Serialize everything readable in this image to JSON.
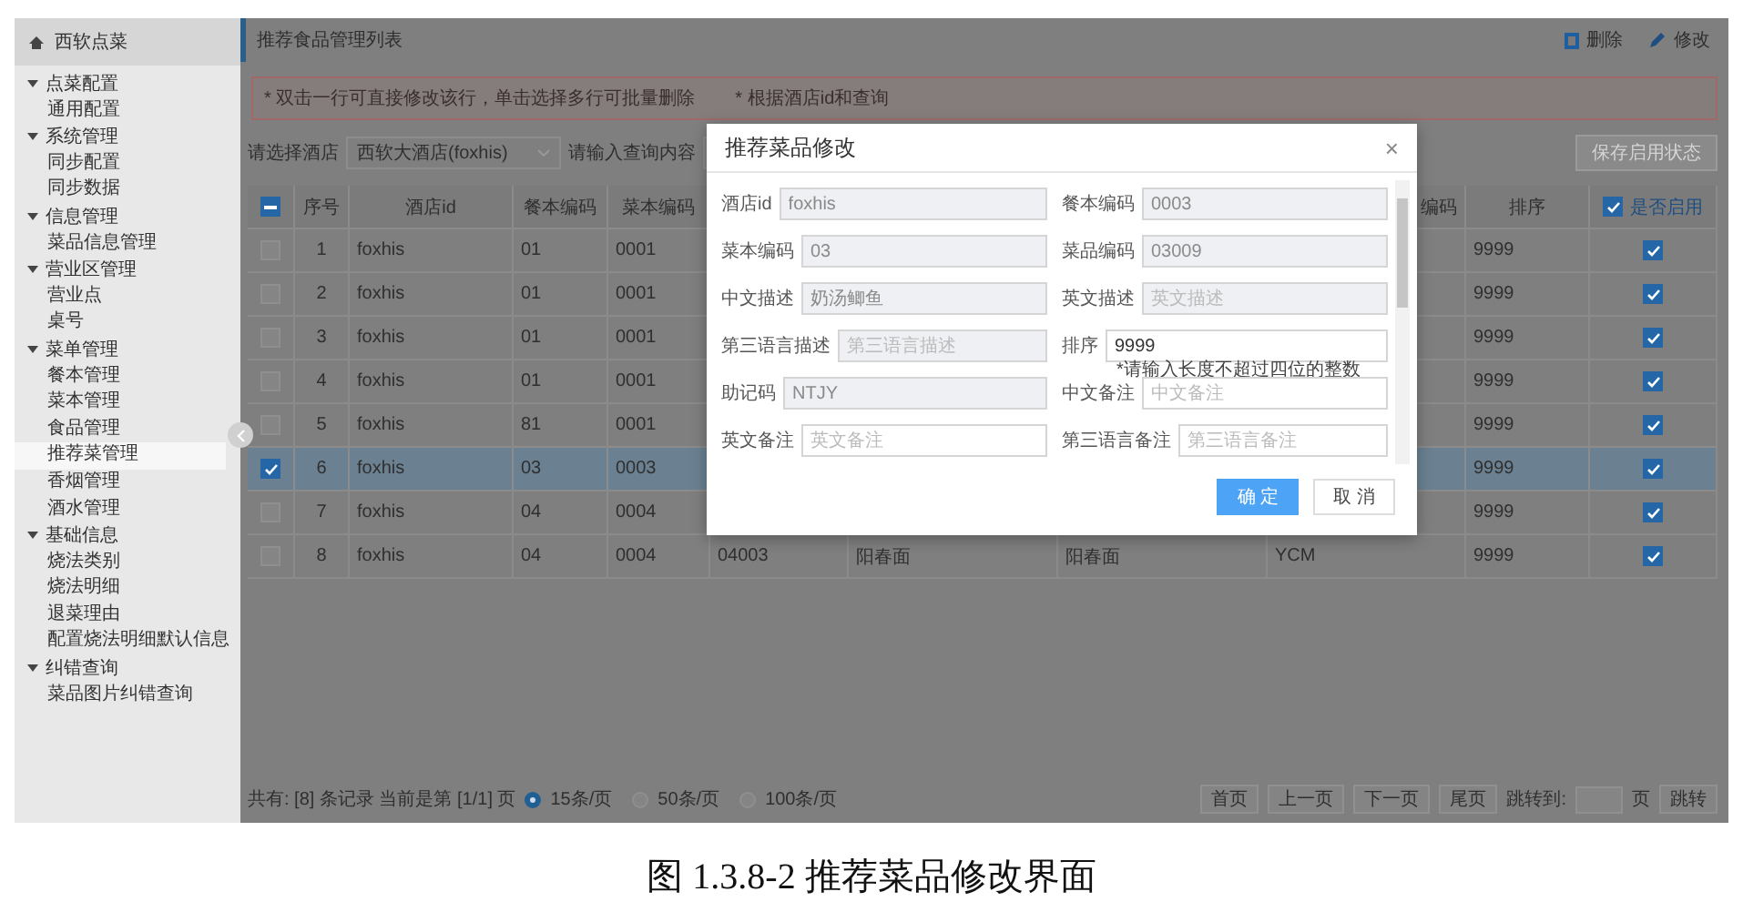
{
  "sidebar": {
    "title": "西软点菜",
    "groups": [
      {
        "label": "点菜配置",
        "expanded": true,
        "children": [
          {
            "label": "通用配置",
            "selected": false
          }
        ]
      },
      {
        "label": "系统管理",
        "expanded": true,
        "children": [
          {
            "label": "同步配置",
            "selected": false
          },
          {
            "label": "同步数据",
            "selected": false
          }
        ]
      },
      {
        "label": "信息管理",
        "expanded": true,
        "children": [
          {
            "label": "菜品信息管理",
            "selected": false
          }
        ]
      },
      {
        "label": "营业区管理",
        "expanded": true,
        "children": [
          {
            "label": "营业点",
            "selected": false
          },
          {
            "label": "桌号",
            "selected": false
          }
        ]
      },
      {
        "label": "菜单管理",
        "expanded": true,
        "children": [
          {
            "label": "餐本管理",
            "selected": false
          },
          {
            "label": "菜本管理",
            "selected": false
          },
          {
            "label": "食品管理",
            "selected": false
          },
          {
            "label": "推荐菜管理",
            "selected": true
          },
          {
            "label": "香烟管理",
            "selected": false
          },
          {
            "label": "酒水管理",
            "selected": false
          }
        ]
      },
      {
        "label": "基础信息",
        "expanded": true,
        "children": [
          {
            "label": "烧法类别",
            "selected": false
          },
          {
            "label": "烧法明细",
            "selected": false
          },
          {
            "label": "退菜理由",
            "selected": false
          },
          {
            "label": "配置烧法明细默认信息",
            "selected": false
          }
        ]
      },
      {
        "label": "纠错查询",
        "expanded": true,
        "children": [
          {
            "label": "菜品图片纠错查询",
            "selected": false
          }
        ]
      }
    ]
  },
  "page_title": "推荐食品管理列表",
  "toolbar": [
    {
      "kind": "delete",
      "label": "删除"
    },
    {
      "kind": "edit",
      "label": "修改"
    }
  ],
  "notices": [
    "* 双击一行可直接修改该行，单击选择多行可批量删除",
    "* 根据酒店id和查询"
  ],
  "filter": {
    "hotel_label": "请选择酒店",
    "hotel_value": "西软大酒店(foxhis)",
    "query_label": "请输入查询内容",
    "save_button": "保存启用状态"
  },
  "table": {
    "select_all_indeterminate": true,
    "columns": [
      "序号",
      "酒店id",
      "餐本编码",
      "菜本编码",
      "编码",
      "排序",
      "是否启用"
    ],
    "enable_all_checked": true,
    "rows": [
      {
        "no": "1",
        "hotel_id": "foxhis",
        "menu_code": "01",
        "book_code": "0001",
        "sort": "9999",
        "checked": false,
        "enabled": true,
        "selected": false
      },
      {
        "no": "2",
        "hotel_id": "foxhis",
        "menu_code": "01",
        "book_code": "0001",
        "sort": "9999",
        "checked": false,
        "enabled": true,
        "selected": false
      },
      {
        "no": "3",
        "hotel_id": "foxhis",
        "menu_code": "01",
        "book_code": "0001",
        "sort": "9999",
        "checked": false,
        "enabled": true,
        "selected": false
      },
      {
        "no": "4",
        "hotel_id": "foxhis",
        "menu_code": "01",
        "book_code": "0001",
        "sort": "9999",
        "checked": false,
        "enabled": true,
        "selected": false
      },
      {
        "no": "5",
        "hotel_id": "foxhis",
        "menu_code": "81",
        "book_code": "0001",
        "sort": "9999",
        "checked": false,
        "enabled": true,
        "selected": false
      },
      {
        "no": "6",
        "hotel_id": "foxhis",
        "menu_code": "03",
        "book_code": "0003",
        "sort": "9999",
        "checked": true,
        "enabled": true,
        "selected": true
      },
      {
        "no": "7",
        "hotel_id": "foxhis",
        "menu_code": "04",
        "book_code": "0004",
        "sort": "9999",
        "checked": false,
        "enabled": true,
        "selected": false
      },
      {
        "no": "8",
        "hotel_id": "foxhis",
        "menu_code": "04",
        "book_code": "0004",
        "middle": [
          "04003",
          "阳春面",
          "阳春面",
          "YCM"
        ],
        "sort": "9999",
        "checked": false,
        "enabled": true,
        "selected": false
      }
    ]
  },
  "footer": {
    "summary": "共有: [8] 条记录 当前是第 [1/1] 页",
    "page_sizes": [
      {
        "label": "15条/页",
        "selected": true
      },
      {
        "label": "50条/页",
        "selected": false
      },
      {
        "label": "100条/页",
        "selected": false
      }
    ],
    "nav": [
      "首页",
      "上一页",
      "下一页",
      "尾页"
    ],
    "jump_label": "跳转到:",
    "page_unit": "页",
    "jump_button": "跳转"
  },
  "dialog": {
    "title": "推荐菜品修改",
    "close": "×",
    "fields": [
      {
        "label": "酒店id",
        "value": "foxhis",
        "disabled": true
      },
      {
        "label": "餐本编码",
        "value": "0003",
        "disabled": true
      },
      {
        "label": "菜本编码",
        "value": "03",
        "disabled": true
      },
      {
        "label": "菜品编码",
        "value": "03009",
        "disabled": true
      },
      {
        "label": "中文描述",
        "value": "奶汤鲫鱼",
        "disabled": true
      },
      {
        "label": "英文描述",
        "placeholder": "英文描述",
        "disabled": true
      },
      {
        "label": "第三语言描述",
        "placeholder": "第三语言描述",
        "disabled": true
      },
      {
        "label": "排序",
        "value": "9999",
        "disabled": false,
        "hint": "*请输入长度不超过四位的整数"
      },
      {
        "label": "助记码",
        "value": "NTJY",
        "disabled": true
      },
      {
        "label": "中文备注",
        "placeholder": "中文备注",
        "disabled": false
      },
      {
        "label": "英文备注",
        "placeholder": "英文备注",
        "disabled": false
      },
      {
        "label": "第三语言备注",
        "placeholder": "第三语言备注",
        "disabled": false
      }
    ],
    "buttons": [
      {
        "kind": "primary",
        "label": "确 定"
      },
      {
        "kind": "default",
        "label": "取 消"
      }
    ]
  },
  "caption": "图 1.3.8-2 推荐菜品修改界面"
}
